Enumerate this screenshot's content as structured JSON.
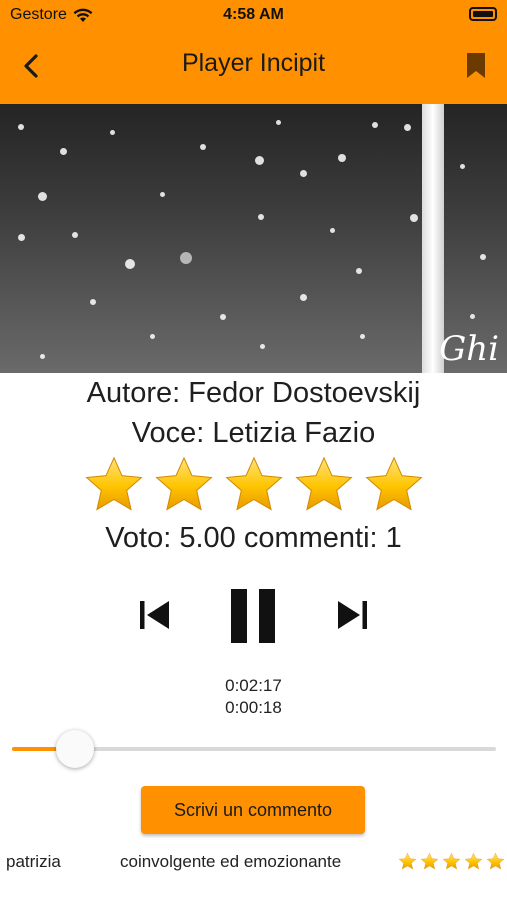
{
  "status_bar": {
    "carrier": "Gestore",
    "time": "4:58 AM"
  },
  "header": {
    "title": "Player Incipit",
    "back_icon": "chevron-left-icon",
    "bookmark_icon": "bookmark-icon"
  },
  "video": {
    "signature": "Ghi"
  },
  "book": {
    "author_line": "Autore: Fedor Dostoevskij",
    "voice_line": "Voce: Letizia Fazio",
    "rating_stars": 5,
    "rating_line": "Voto: 5.00 commenti: 1"
  },
  "player": {
    "total_time": "0:02:17",
    "elapsed_time": "0:00:18",
    "progress_fraction": 0.131,
    "prev_icon": "skip-previous-icon",
    "pause_icon": "pause-icon",
    "next_icon": "skip-next-icon"
  },
  "actions": {
    "write_comment": "Scrivi un commento"
  },
  "comments": [
    {
      "user": "patrizia",
      "text": "coinvolgente ed emozionante",
      "stars": 5
    }
  ],
  "colors": {
    "accent": "#ff9100",
    "star": "#ffc400"
  }
}
